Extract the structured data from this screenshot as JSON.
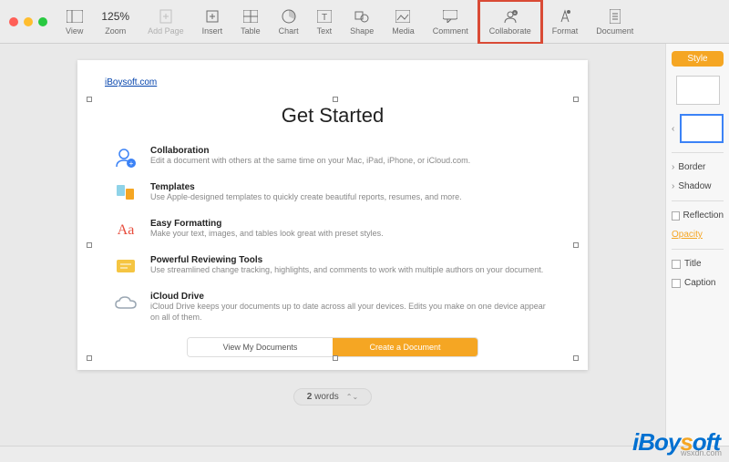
{
  "toolbar": {
    "zoom_value": "125%",
    "view": "View",
    "zoom": "Zoom",
    "add_page": "Add Page",
    "insert": "Insert",
    "table": "Table",
    "chart": "Chart",
    "text": "Text",
    "shape": "Shape",
    "media": "Media",
    "comment": "Comment",
    "collaborate": "Collaborate",
    "format": "Format",
    "document": "Document"
  },
  "page": {
    "link_header": "iBoysoft.com",
    "heading": "Get Started",
    "features": [
      {
        "title": "Collaboration",
        "desc": "Edit a document with others at the same time on your Mac, iPad, iPhone, or iCloud.com."
      },
      {
        "title": "Templates",
        "desc": "Use Apple-designed templates to quickly create beautiful reports, resumes, and more."
      },
      {
        "title": "Easy Formatting",
        "desc": "Make your text, images, and tables look great with preset styles."
      },
      {
        "title": "Powerful Reviewing Tools",
        "desc": "Use streamlined change tracking, highlights, and comments to work with multiple authors on your document."
      },
      {
        "title": "iCloud Drive",
        "desc": "iCloud Drive keeps your documents up to date across all your devices. Edits you make on one device appear on all of them."
      }
    ],
    "button_view": "View My Documents",
    "button_create": "Create a Document"
  },
  "status": {
    "word_count_num": "2",
    "word_count_label": " words"
  },
  "sidebar": {
    "style": "Style",
    "border": "Border",
    "shadow": "Shadow",
    "reflection": "Reflection",
    "opacity": "Opacity",
    "title": "Title",
    "caption": "Caption"
  },
  "footer": {
    "credit": "wsxdn.com"
  },
  "watermark": {
    "pre": "iBoy",
    "mid": "s",
    "post": "oft"
  }
}
